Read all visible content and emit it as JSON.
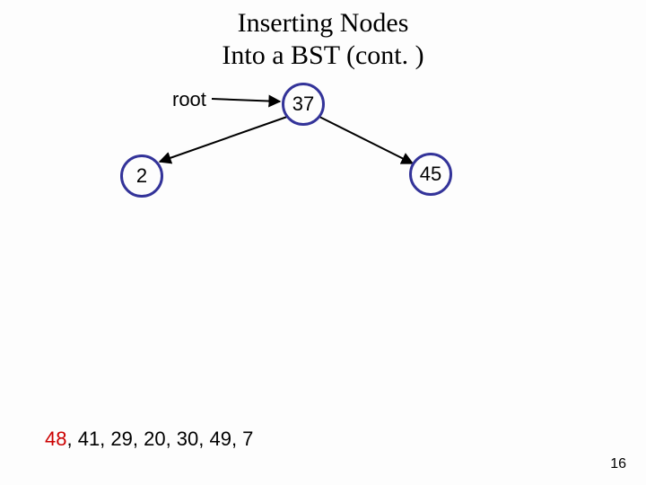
{
  "title_line1": "Inserting Nodes",
  "title_line2": "Into a BST (cont. )",
  "root_label": "root",
  "nodes": {
    "root": "37",
    "left": "2",
    "right": "45"
  },
  "pending": {
    "highlight": "48",
    "rest": ", 41, 29, 20, 30, 49, 7"
  },
  "page_number": "16",
  "chart_data": {
    "type": "table",
    "title": "Binary search tree during insertion",
    "tree": {
      "root": 37,
      "children": [
        {
          "value": 2,
          "side": "left"
        },
        {
          "value": 45,
          "side": "right"
        }
      ]
    },
    "pending_insertions": [
      48,
      41,
      29,
      20,
      30,
      49,
      7
    ],
    "current_to_insert": 48,
    "root_pointer_label": "root"
  }
}
